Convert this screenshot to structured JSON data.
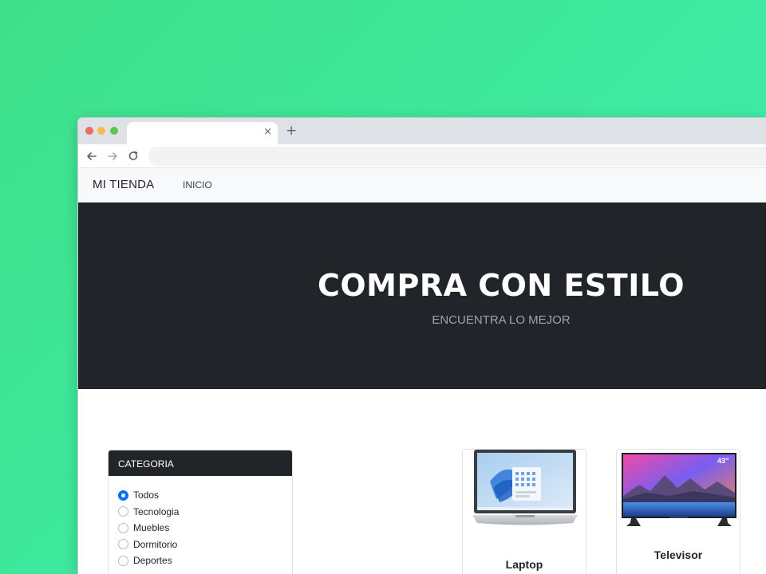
{
  "browser": {
    "tab_close": "×",
    "new_tab": "+"
  },
  "navbar": {
    "brand": "MI TIENDA",
    "links": [
      "INICIO"
    ]
  },
  "hero": {
    "title": "COMPRA CON ESTILO",
    "subtitle": "ENCUENTRA LO MEJOR"
  },
  "sidebar": {
    "title": "CATEGORIA",
    "categories": [
      {
        "label": "Todos",
        "checked": true
      },
      {
        "label": "Tecnologia",
        "checked": false
      },
      {
        "label": "Muebles",
        "checked": false
      },
      {
        "label": "Dormitorio",
        "checked": false
      },
      {
        "label": "Deportes",
        "checked": false
      }
    ]
  },
  "products": [
    {
      "name": "Laptop",
      "image": "laptop-image"
    },
    {
      "name": "Televisor",
      "image": "tv-image",
      "badge": "43\""
    }
  ],
  "colors": {
    "hero_bg": "#212529",
    "accent": "#0d6efd",
    "background_gradient": [
      "#3fe089",
      "#3ef0b8"
    ]
  }
}
